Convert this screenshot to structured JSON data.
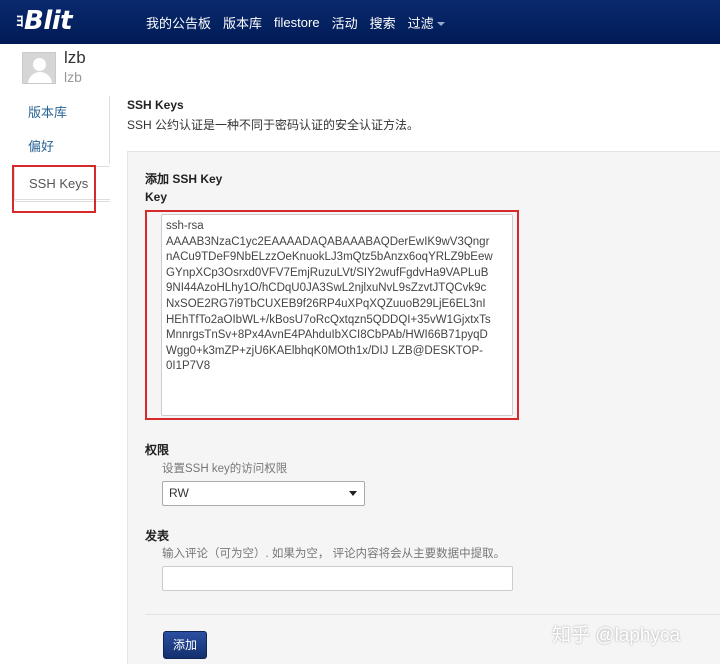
{
  "brand": {
    "prefix": "ﾖ",
    "name": "Blit"
  },
  "nav": {
    "items": [
      {
        "label": "我的公告板"
      },
      {
        "label": "版本库"
      },
      {
        "label": "filestore"
      },
      {
        "label": "活动"
      },
      {
        "label": "搜索"
      },
      {
        "label": "过滤"
      }
    ]
  },
  "user": {
    "username": "lzb",
    "display_name": "lzb"
  },
  "sidebar": {
    "items": [
      {
        "label": "版本库"
      },
      {
        "label": "偏好"
      },
      {
        "label": "SSH Keys"
      }
    ],
    "active_index": 2
  },
  "section": {
    "title": "SSH Keys",
    "description": "SSH 公约认证是一种不同于密码认证的安全认证方法。"
  },
  "form": {
    "title": "添加 SSH Key",
    "key_label": "Key",
    "key_lines": [
      "ssh-rsa",
      "AAAAB3NzaC1yc2EAAAADAQABAAABAQDerEwIK9wV3Qngr",
      "nACu9TDeF9NbELzzOeKnuokLJ3mQtz5bAnzx6oqYRLZ9bEew",
      "GYnpXCp3Osrxd0VFV7EmjRuzuLVt/SIY2wufFgdvHa9VAPLuB",
      "9NI44AzoHLhy1O/hCDqU0JA3SwL2njlxuNvL9sZzvtJTQCvk9c",
      "NxSOE2RG7i9TbCUXEB9f26RP4uXPqXQZuuoB29LjE6EL3nI",
      "HEhTfTo2aOIbWL+/kBosU7oRcQxtqzn5QDDQI+35vW1GjxtxTs",
      "MnnrgsTnSv+8Px4AvnE4PAhduIbXCI8CbPAb/HWI66B71pyqD",
      "Wgg0+k3mZP+zjU6KAElbhqK0MOth1x/DIJ LZB@DESKTOP-",
      "0I1P7V8"
    ],
    "permission_label": "权限",
    "permission_help": "设置SSH key的访问权限",
    "permission_value": "RW",
    "comment_label": "发表",
    "comment_help": "输入评论（可为空）. 如果为空， 评论内容将会从主要数据中提取。",
    "comment_value": "",
    "submit_label": "添加"
  },
  "watermark": {
    "text": "知乎 @laphyca"
  },
  "colors": {
    "navbar": "#0a2a6e",
    "link": "#2a6496",
    "highlight": "#d62a2a",
    "button": "#1e3f8a",
    "panel": "#f5f5f5"
  }
}
